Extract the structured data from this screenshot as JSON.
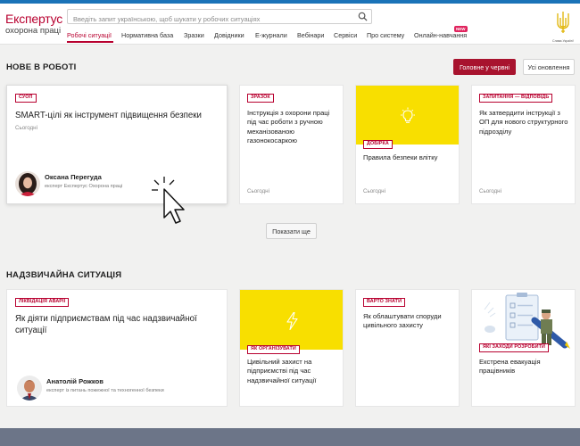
{
  "header": {
    "logo_line1": "Експертус",
    "logo_line2": "охорона праці",
    "search_placeholder": "Введіть запит українською, щоб шукати у робочих ситуаціях",
    "emblem_caption": "Слава Україні!"
  },
  "tabs": [
    {
      "label": "Робочі ситуації",
      "active": true
    },
    {
      "label": "Нормативна база"
    },
    {
      "label": "Зразки"
    },
    {
      "label": "Довідники"
    },
    {
      "label": "Е-журнали"
    },
    {
      "label": "Вебінари"
    },
    {
      "label": "Сервіси"
    },
    {
      "label": "Про систему"
    },
    {
      "label": "Онлайн-навчання",
      "badge": "NEW"
    }
  ],
  "section1": {
    "title": "НОВЕ В РОБОТІ",
    "btn_primary": "Головне у червні",
    "btn_secondary": "Усі оновлення",
    "show_more": "Показати ще",
    "cards": [
      {
        "badge": "СУОП",
        "title": "SMART-цілі як інструмент підвищення безпеки",
        "date": "Сьогодні",
        "author_name": "Оксана Перегуда",
        "author_role": "експерт Експертус Охорона праці"
      },
      {
        "badge": "ЗРАЗОК",
        "title": "Інструкція з охорони праці під час роботи з ручною механізованою газонокосаркою",
        "date": "Сьогодні"
      },
      {
        "badge": "ДОБІРКА",
        "title": "Правила безпеки влітку",
        "date": "Сьогодні",
        "icon": "lightbulb-icon"
      },
      {
        "badge": "ЗАПИТАННЯ — ВІДПОВІДЬ",
        "title": "Як затвердити інструкції з ОП для нового структурного підрозділу",
        "date": "Сьогодні"
      }
    ]
  },
  "section2": {
    "title": "НАДЗВИЧАЙНА СИТУАЦІЯ",
    "cards": [
      {
        "badge": "ЛІКВІДАЦІЯ АВАРІЇ",
        "title": "Як діяти підприємствам під час надзвичайної ситуації",
        "author_name": "Анатолій Рожков",
        "author_role": "експерт із питань пожежної та техногенної безпеки"
      },
      {
        "badge": "ЯК ОРГАНІЗУВАТИ",
        "title": "Цивільний захист на підприємстві під час надзвичайної ситуації",
        "icon": "lightning-icon"
      },
      {
        "badge": "ВАРТО ЗНАТИ",
        "title": "Як облаштувати споруди цивільного захисту"
      },
      {
        "badge": "ЯКІ ЗАХОДИ РОЗРОБИТИ",
        "title": "Екстрена евакуація працівників"
      }
    ]
  },
  "colors": {
    "brand": "#b8002f",
    "primary_button": "#a8132e",
    "topbar": "#1a73b8",
    "yellow": "#f8df00",
    "footer": "#6c7588"
  }
}
